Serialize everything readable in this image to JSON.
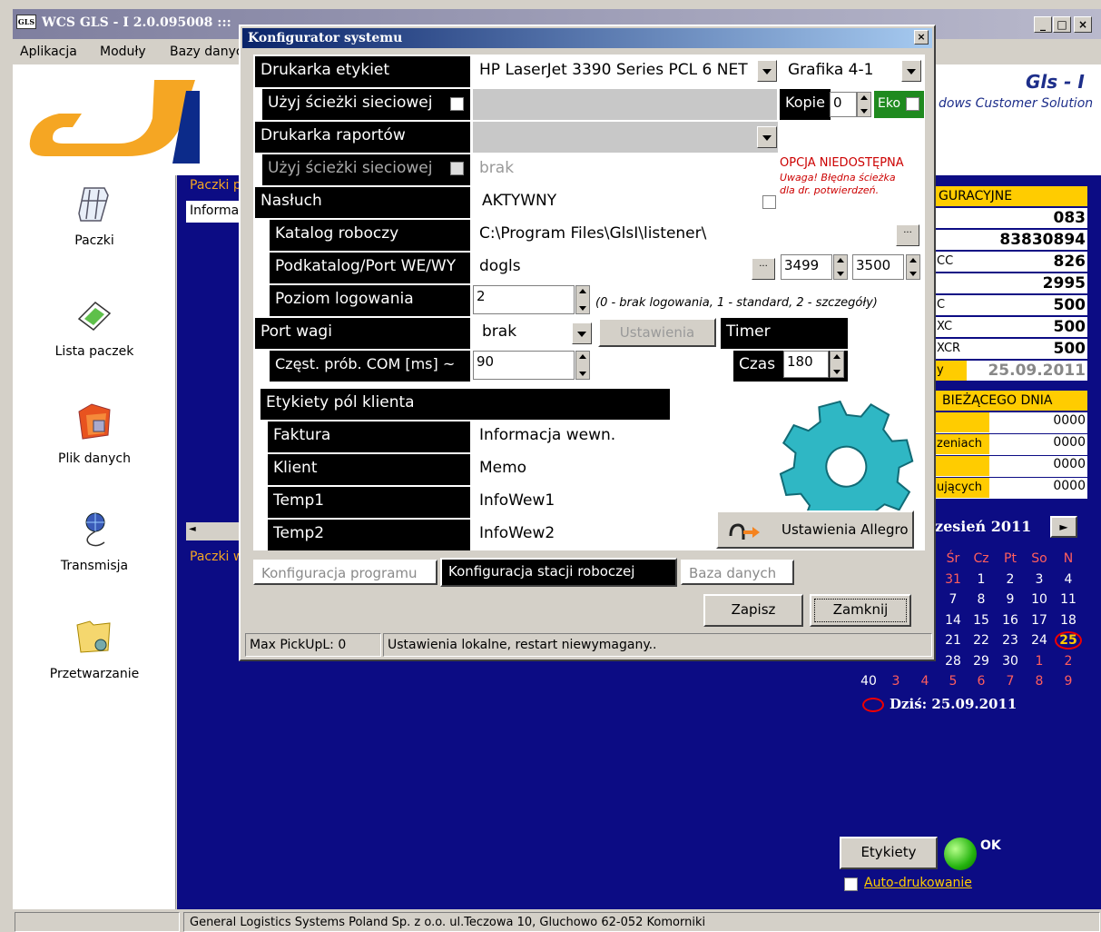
{
  "main_window": {
    "title": "WCS GLS - I  2.0.095008 :::",
    "min_label": "_",
    "max_label": "□",
    "close_label": "×"
  },
  "menu": [
    "Aplikacja",
    "Moduły",
    "Bazy danych"
  ],
  "branding": {
    "name": "Gls - I",
    "subtitle": "dows Customer Solution"
  },
  "nav": [
    {
      "label": "Paczki",
      "icon": "packages-icon"
    },
    {
      "label": "Lista  paczek",
      "icon": "parcel-list-icon"
    },
    {
      "label": "Plik danych",
      "icon": "data-file-icon"
    },
    {
      "label": "Transmisja",
      "icon": "transmission-icon"
    },
    {
      "label": "Przetwarzanie",
      "icon": "processing-icon"
    }
  ],
  "center": {
    "section1": "Paczki p",
    "tab1": "Informa",
    "section2": "Paczki w"
  },
  "info": {
    "header": "GURACYJNE",
    "rows": [
      {
        "label": "",
        "value": "083"
      },
      {
        "label": "",
        "value": "83830894"
      },
      {
        "label": "CC",
        "value": "826"
      },
      {
        "label": "",
        "value": "2995"
      },
      {
        "label": "C",
        "value": "500"
      },
      {
        "label": "XC",
        "value": "500"
      },
      {
        "label": "XCR",
        "value": "500"
      },
      {
        "label": "y",
        "value": "25.09.2011"
      }
    ],
    "header2": "BIEŻĄCEGO DNIA",
    "rows2": [
      {
        "label": "",
        "value": "0000"
      },
      {
        "label": "zeniach",
        "value": "0000"
      },
      {
        "label": "",
        "value": "0000"
      },
      {
        "label": "ujących",
        "value": "0000"
      }
    ]
  },
  "calendar": {
    "month": "zesień 2011",
    "next": "►",
    "days_header": [
      "Śr",
      "Cz",
      "Pt",
      "So",
      "N"
    ],
    "rows": [
      [
        "31",
        "1",
        "2",
        "3",
        "4"
      ],
      [
        "7",
        "8",
        "9",
        "10",
        "11"
      ],
      [
        "14",
        "15",
        "16",
        "17",
        "18"
      ],
      [
        "21",
        "22",
        "23",
        "24",
        "25"
      ],
      [
        "28",
        "29",
        "30",
        "1",
        "2"
      ]
    ],
    "last_row": [
      "40",
      "3",
      "4",
      "5",
      "6",
      "7",
      "8",
      "9"
    ],
    "today": "Dziś: 25.09.2011"
  },
  "right_bottom": {
    "labels_button": "Etykiety",
    "ok": "OK",
    "auto_print": "Auto-drukowanie"
  },
  "status_bar": {
    "company": "General Logistics Systems Poland Sp. z o.o. ul.Teczowa 10, Gluchowo 62-052 Komorniki"
  },
  "dialog": {
    "title": "Konfigurator systemu",
    "close_label": "×",
    "label_printer": {
      "label": "Drukarka etykiet",
      "value": "HP LaserJet 3390 Series PCL 6 NET",
      "mode": "Grafika 4-1"
    },
    "use_net_path_1": {
      "label": "Użyj ścieżki sieciowej",
      "copies_label": "Kopie",
      "copies_value": "0",
      "eko_label": "Eko"
    },
    "report_printer": {
      "label": "Drukarka raportów",
      "value": ""
    },
    "use_net_path_2": {
      "label": "Użyj ścieżki sieciowej",
      "value": "brak"
    },
    "warning": {
      "title": "OPCJA NIEDOSTĘPNA",
      "line1": "Uwaga! Błędna ścieżka",
      "line2": "dla dr. potwierdzeń."
    },
    "listener": {
      "label": "Nasłuch",
      "value": "AKTYWNY"
    },
    "work_dir": {
      "label": "Katalog roboczy",
      "value": "C:\\Program Files\\GlsI\\listener\\",
      "browse": "..."
    },
    "subdir_port": {
      "label": "Podkatalog/Port WE/WY",
      "value": "dogls",
      "browse": "...",
      "port_in": "3499",
      "port_out": "3500"
    },
    "log_level": {
      "label": "Poziom logowania",
      "value": "2",
      "hint": "(0 - brak logowania, 1 - standard, 2 - szczegóły)"
    },
    "scale_port": {
      "label": "Port wagi",
      "value": "brak",
      "settings_button": "Ustawienia"
    },
    "timer": {
      "label": "Timer",
      "time_label": "Czas",
      "time_value": "180"
    },
    "com_freq": {
      "label": "Częst.  prób. COM [ms] ~",
      "value": "90"
    },
    "client_labels": {
      "header": "Etykiety pól klienta",
      "rows": [
        {
          "label": "Faktura",
          "value": "Informacja wewn."
        },
        {
          "label": "Klient",
          "value": "Memo"
        },
        {
          "label": "Temp1",
          "value": "InfoWew1"
        },
        {
          "label": "Temp2",
          "value": "InfoWew2"
        }
      ]
    },
    "allegro_button": "Ustawienia Allegro",
    "tabs": [
      "Konfiguracja programu",
      "Konfiguracja stacji roboczej",
      "Baza danych"
    ],
    "save_button": "Zapisz",
    "close_button": "Zamknij",
    "status_left": "Max PickUpL: 0",
    "status_right": "Ustawienia lokalne, restart niewymagany.."
  },
  "colors": {
    "dark_blue": "#0c0c84",
    "yellow": "#ffcc00",
    "accent_orange": "#f5a623",
    "warning_red": "#cc0000"
  }
}
